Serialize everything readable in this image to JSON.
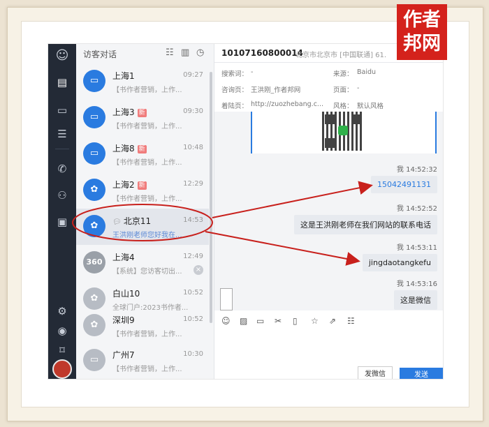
{
  "watermark": {
    "line1": "作者",
    "line2": "邦网"
  },
  "list": {
    "title": "访客对话",
    "items": [
      {
        "name": "上海1",
        "time": "09:27",
        "preview": "【书作者营销，上作...",
        "avatar": "monitor",
        "new": ""
      },
      {
        "name": "上海3",
        "time": "09:30",
        "preview": "【书作者营销，上作...",
        "avatar": "monitor",
        "new": "新"
      },
      {
        "name": "上海8",
        "time": "10:48",
        "preview": "【书作者营销，上作...",
        "avatar": "monitor",
        "new": "新"
      },
      {
        "name": "上海2",
        "time": "12:29",
        "preview": "【书作者营销，上作...",
        "avatar": "baidu",
        "new": "新"
      },
      {
        "name": "北京11",
        "time": "14:53",
        "preview": "王洪刚老师您好我在...",
        "avatar": "baidu",
        "new": ""
      },
      {
        "name": "上海4",
        "time": "12:49",
        "preview": "【系统】您访客切出...",
        "avatar": "360",
        "new": ""
      },
      {
        "name": "白山10",
        "time": "10:52",
        "preview": "全球门户:2023书作者...",
        "avatar": "baidu-gray",
        "new": ""
      },
      {
        "name": "深圳9",
        "time": "10:52",
        "preview": "【书作者营销，上作...",
        "avatar": "baidu-gray",
        "new": ""
      },
      {
        "name": "广州7",
        "time": "10:30",
        "preview": "【书作者营销，上作...",
        "avatar": "monitor-gray",
        "new": ""
      }
    ]
  },
  "chat": {
    "visitor_id": "10107160800014",
    "location": "北京市北京市 [中国联通] 61.",
    "info": {
      "search_label": "搜索词：",
      "search_value": "-",
      "source_label": "来源：",
      "source_value": "Baidu",
      "consult_label": "咨询页：",
      "consult_value": "王洪刚_作者邦网",
      "page_label": "页面：",
      "page_value": "-",
      "landing_label": "着陆页：",
      "landing_value": "http://zuozhebang.c...",
      "style_label": "风格：",
      "style_value": "默认风格"
    },
    "messages": [
      {
        "meta": "我 14:52:32",
        "text": "15042491131",
        "kind": "phone"
      },
      {
        "meta": "我 14:52:52",
        "text": "这是王洪刚老师在我们网站的联系电话",
        "kind": "text"
      },
      {
        "meta": "我 14:53:11",
        "text": "jingdaotangkefu",
        "kind": "text"
      },
      {
        "meta": "我 14:53:16",
        "text": "这是微信",
        "kind": "text"
      }
    ],
    "wechat_button": "发微信",
    "send_button": "发送"
  },
  "annotation": {
    "color": "#c8201c"
  }
}
